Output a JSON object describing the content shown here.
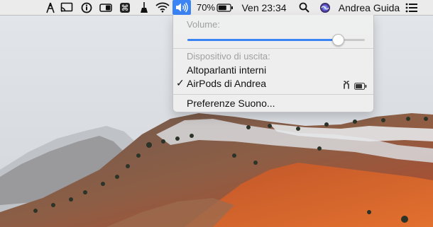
{
  "menubar": {
    "icons": [
      "airdrop-icon",
      "cast-icon",
      "info-icon",
      "toggle-icon",
      "command-icon",
      "broom-icon",
      "wifi-icon",
      "volume-icon",
      "battery-icon",
      "search-icon",
      "siri-icon",
      "list-icon"
    ],
    "battery_percent": "70%",
    "clock": "Ven 23:34",
    "user": "Andrea Guida"
  },
  "volume_menu": {
    "volume_label": "Volume:",
    "volume_level": 0.87,
    "output_label": "Dispositivo di uscita:",
    "devices": [
      {
        "name": "Altoparlanti interni",
        "selected": false
      },
      {
        "name": "AirPods di Andrea",
        "selected": true
      }
    ],
    "checkmark": "✓",
    "preferences": "Preferenze Suono..."
  },
  "colors": {
    "accent": "#3b84f5",
    "menubar": "#ececec"
  }
}
